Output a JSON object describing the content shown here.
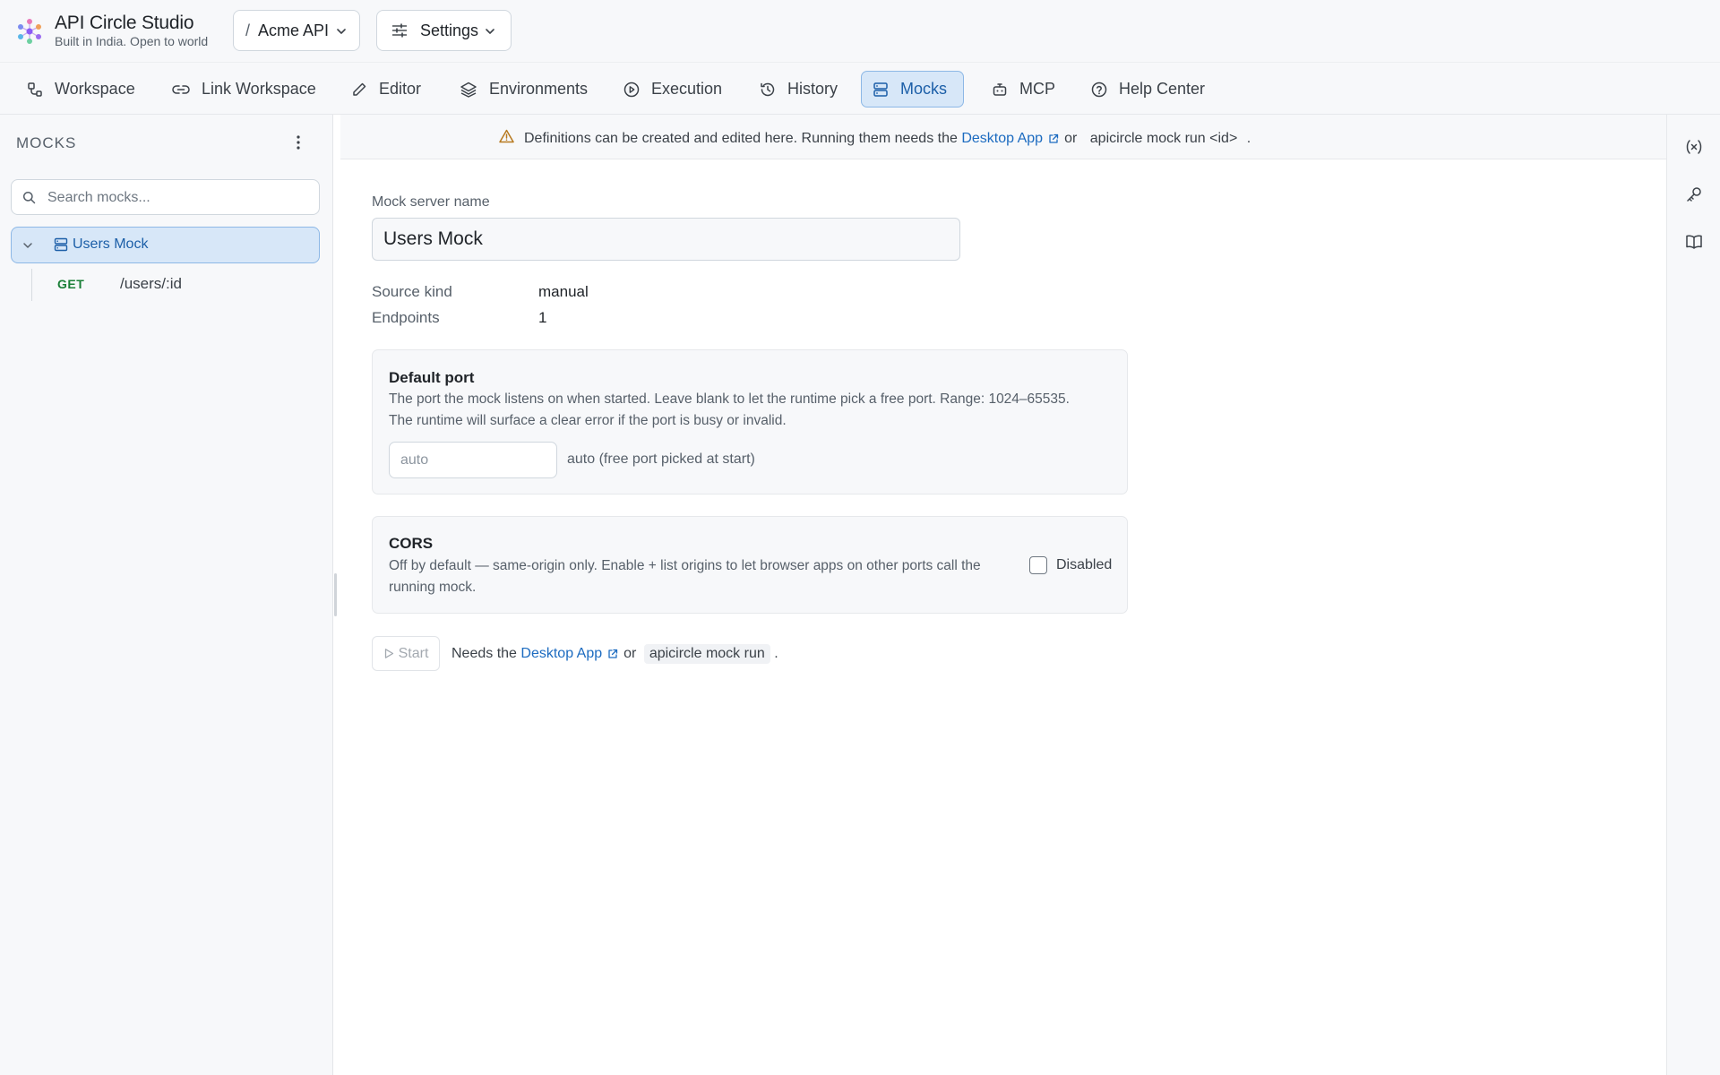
{
  "app": {
    "title": "API Circle Studio",
    "subtitle": "Built in India. Open to world"
  },
  "header": {
    "project_slash": "/",
    "project": "Acme API",
    "settings": "Settings"
  },
  "nav": [
    {
      "label": "Workspace",
      "icon": "workspace-icon"
    },
    {
      "label": "Link Workspace",
      "icon": "link-icon"
    },
    {
      "label": "Editor",
      "icon": "pencil-icon"
    },
    {
      "label": "Environments",
      "icon": "layers-icon"
    },
    {
      "label": "Execution",
      "icon": "play-circle-icon"
    },
    {
      "label": "History",
      "icon": "history-icon"
    },
    {
      "label": "Mocks",
      "icon": "server-icon",
      "active": true
    },
    {
      "label": "MCP",
      "icon": "bot-icon"
    },
    {
      "label": "Help Center",
      "icon": "help-circle-icon"
    }
  ],
  "sidebar": {
    "title": "MOCKS",
    "search_placeholder": "Search mocks...",
    "mocks": [
      {
        "name": "Users Mock",
        "expanded": true,
        "endpoints": [
          {
            "method": "GET",
            "path": "/users/:id"
          }
        ]
      }
    ]
  },
  "banner": {
    "text_before": "Definitions can be created and edited here. Running them needs the",
    "link": "Desktop App",
    "or": "or",
    "command": "apicircle mock run <id>",
    "end": "."
  },
  "main": {
    "name_label": "Mock server name",
    "name_value": "Users Mock",
    "source_kind_label": "Source kind",
    "source_kind_value": "manual",
    "endpoints_label": "Endpoints",
    "endpoints_value": "1",
    "port": {
      "title": "Default port",
      "desc_line1": "The port the mock listens on when started. Leave blank to let the runtime pick a free port. Range: 1024–65535.",
      "desc_line2": "The runtime will surface a clear error if the port is busy or invalid.",
      "placeholder": "auto",
      "hint": "auto (free port picked at start)"
    },
    "cors": {
      "title": "CORS",
      "desc_line1": "Off by default — same-origin only. Enable + list origins to let browser apps on other ports call the",
      "desc_line2": "running mock.",
      "checkbox_label": "Disabled",
      "enabled": false
    },
    "start": {
      "label": "Start",
      "needs_before": "Needs the",
      "link": "Desktop App",
      "or": "or",
      "command": "apicircle mock run",
      "end": "."
    }
  },
  "rail": [
    "variable-icon",
    "key-icon",
    "book-icon"
  ],
  "colors": {
    "accent": "#1c6bc0",
    "active_bg": "#d7e7f8",
    "active_border": "#8db8e6",
    "get_method": "#1a7f37",
    "warning": "#b7791f"
  }
}
